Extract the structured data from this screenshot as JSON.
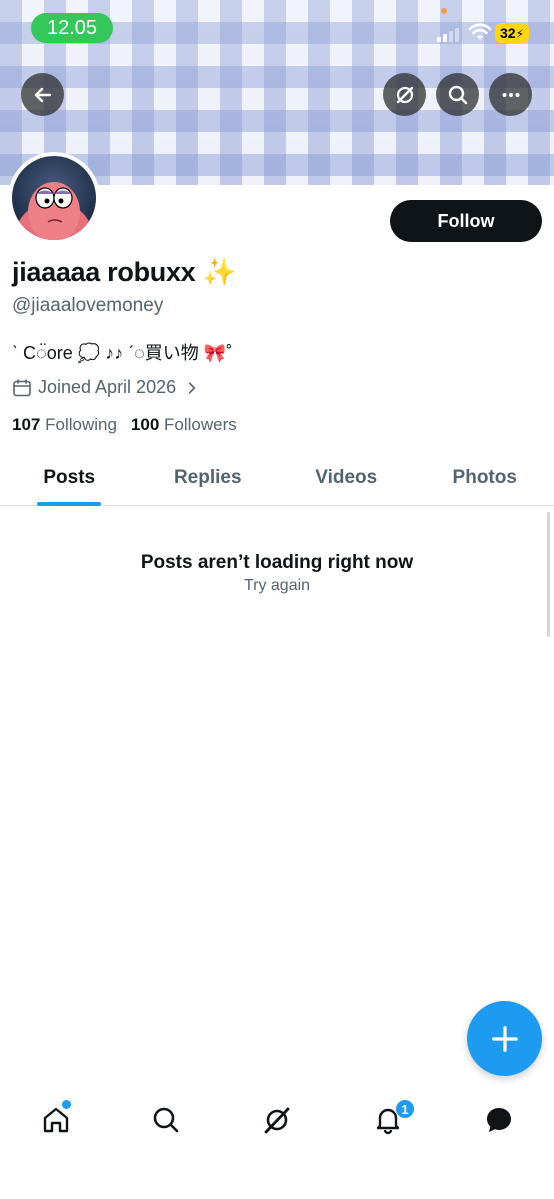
{
  "status_bar": {
    "time": "12.05",
    "battery": "32"
  },
  "profile": {
    "display_name": "jiaaaaa robuxx ✨",
    "handle": "@jiaaalovemoney",
    "bio": "ˋ C◌̈ore 💭 ♪♪ ˊ◌買い物 🎀˚",
    "joined": "Joined April 2026",
    "following_count": "107",
    "following_label": "Following",
    "followers_count": "100",
    "followers_label": "Followers",
    "follow_button": "Follow"
  },
  "tabs": [
    {
      "label": "Posts",
      "active": true
    },
    {
      "label": "Replies",
      "active": false
    },
    {
      "label": "Videos",
      "active": false
    },
    {
      "label": "Photos",
      "active": false
    }
  ],
  "empty_state": {
    "title": "Posts aren’t loading right now",
    "action": "Try again"
  },
  "notifications_badge": "1",
  "icons": {
    "back": "arrow-left-icon",
    "grok": "grok-icon",
    "search": "search-icon",
    "more": "more-icon",
    "calendar": "calendar-icon",
    "chevron": "chevron-right-icon",
    "compose": "plus-icon",
    "nav": [
      "home-icon",
      "search-icon",
      "grok-icon",
      "bell-icon",
      "chat-icon"
    ]
  },
  "colors": {
    "accent": "#1d9bf0",
    "status_green": "#34c759",
    "battery": "#ffd60a"
  }
}
